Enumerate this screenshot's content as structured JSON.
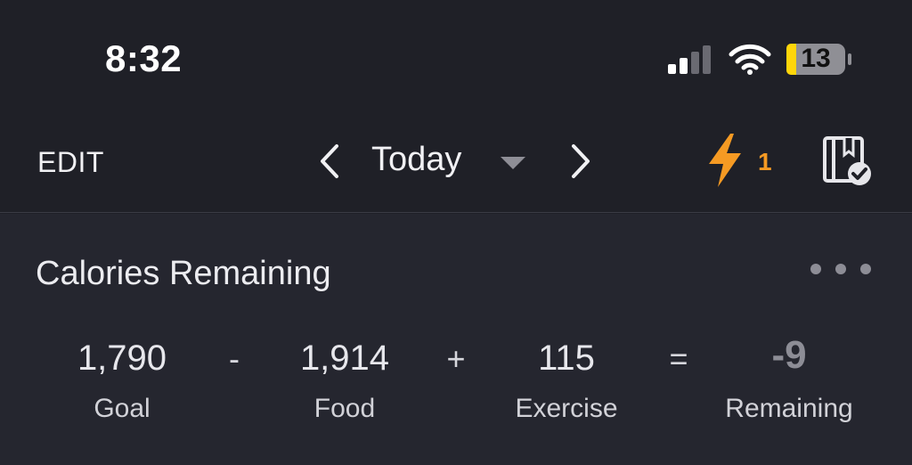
{
  "status_bar": {
    "time": "8:32",
    "battery_level": "13",
    "icons": [
      "signal-icon",
      "wifi-icon",
      "battery-icon"
    ]
  },
  "nav": {
    "edit_label": "EDIT",
    "date_label": "Today",
    "streak_count": "1",
    "icons": [
      "chevron-left-icon",
      "dropdown-caret-icon",
      "chevron-right-icon",
      "lightning-icon",
      "diary-complete-icon"
    ],
    "accent_color": "#f59a23"
  },
  "calories": {
    "title": "Calories Remaining",
    "goal": {
      "value": "1,790",
      "label": "Goal"
    },
    "food": {
      "value": "1,914",
      "label": "Food"
    },
    "exercise": {
      "value": "115",
      "label": "Exercise"
    },
    "remaining": {
      "value": "-9",
      "label": "Remaining"
    },
    "operators": {
      "minus": "-",
      "plus": "+",
      "equals": "="
    },
    "more_icon": "more-horizontal-icon"
  }
}
